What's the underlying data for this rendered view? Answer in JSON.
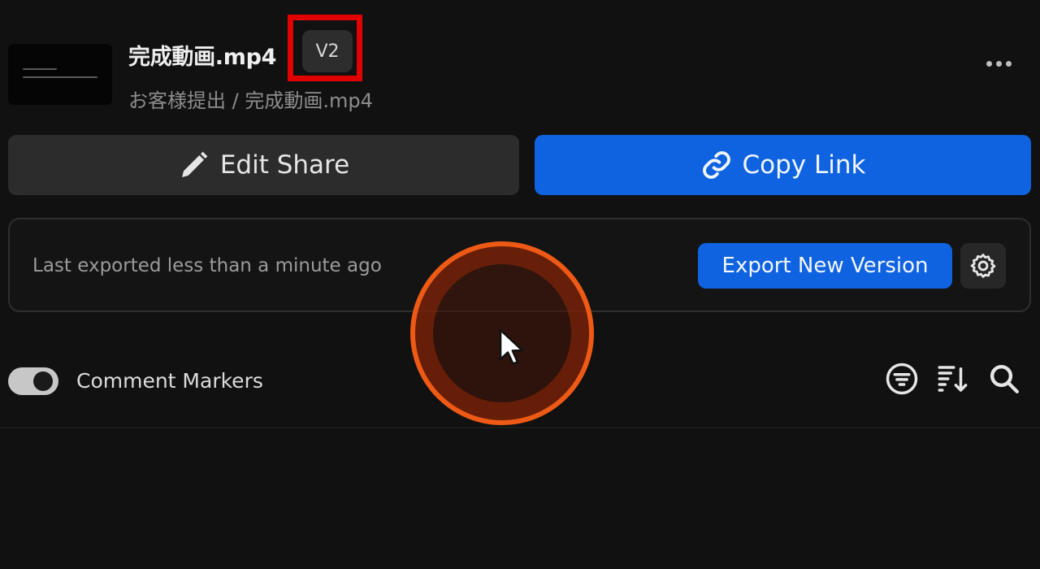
{
  "file": {
    "name": "完成動画.mp4",
    "version": "V2",
    "path": "お客様提出 / 完成動画.mp4"
  },
  "actions": {
    "edit_share_label": "Edit Share",
    "copy_link_label": "Copy Link"
  },
  "export": {
    "status": "Last exported less than a minute ago",
    "button_label": "Export New Version"
  },
  "comments": {
    "markers_label": "Comment Markers",
    "markers_enabled": true
  },
  "icons": {
    "more": "more-horizontal-icon",
    "edit": "pencil-icon",
    "link": "link-icon",
    "settings": "gear-icon",
    "filter": "filter-icon",
    "sort": "sort-icon",
    "search": "search-icon"
  },
  "colors": {
    "background": "#111111",
    "accent_blue": "#0f63e0",
    "highlight_red": "#e00000",
    "click_ring": "#ee5a16"
  }
}
